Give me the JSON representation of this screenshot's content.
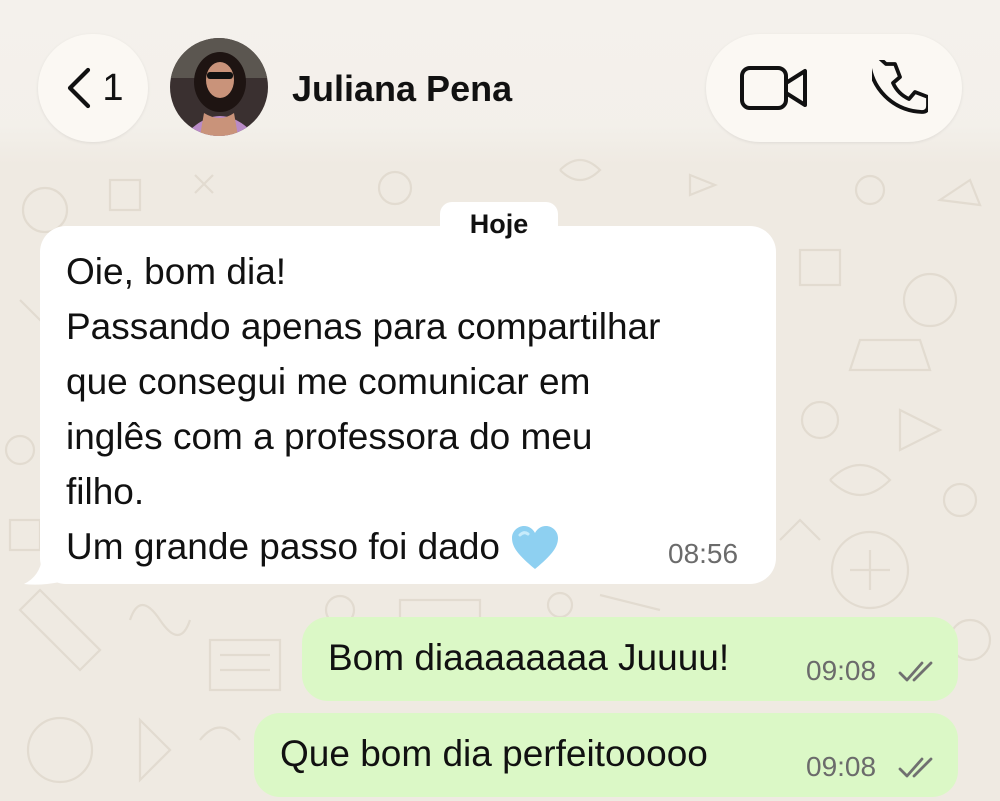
{
  "header": {
    "back_count": "1",
    "contact_name": "Juliana Pena",
    "icons": {
      "back": "chevron-left-icon",
      "video": "video-camera-icon",
      "call": "phone-icon"
    }
  },
  "chat": {
    "date_chip": "Hoje",
    "incoming": {
      "lines": [
        "Oie, bom dia!",
        "Passando apenas para compartilhar",
        "que consegui me comunicar em",
        "inglês com a professora do meu",
        "filho.",
        "Um grande passo foi dado"
      ],
      "emoji": "light-blue-heart",
      "time": "08:56"
    },
    "outgoing": [
      {
        "text": "Bom diaaaaaaaa Juuuu!",
        "time": "09:08",
        "status": "read-double-check-icon"
      },
      {
        "text": "Que bom dia perfeitooooo",
        "time": "09:08",
        "status": "read-double-check-icon"
      }
    ]
  },
  "colors": {
    "background": "#efeae2",
    "incoming_bubble": "#ffffff",
    "outgoing_bubble": "#dbf8c6",
    "heart": "#8ed0f1"
  }
}
